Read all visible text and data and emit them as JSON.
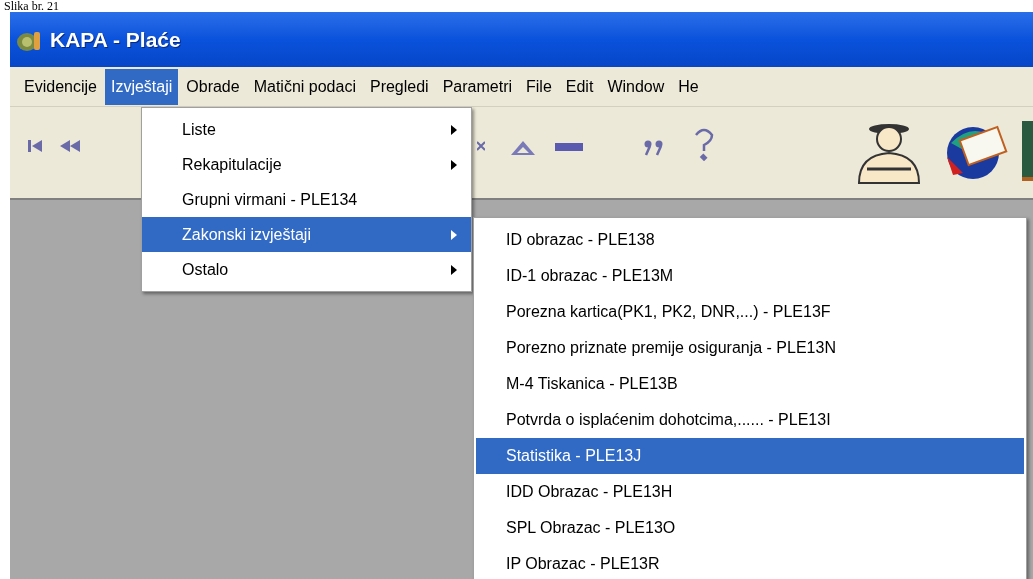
{
  "caption": "Slika br. 21",
  "window": {
    "title": "KAPA - Plaće"
  },
  "menu_bar": [
    {
      "label": "Evidencije",
      "selected": false
    },
    {
      "label": "Izvještaji",
      "selected": true
    },
    {
      "label": "Obrade",
      "selected": false
    },
    {
      "label": "Matični podaci",
      "selected": false
    },
    {
      "label": "Pregledi",
      "selected": false
    },
    {
      "label": "Parametri",
      "selected": false
    },
    {
      "label": "File",
      "selected": false
    },
    {
      "label": "Edit",
      "selected": false
    },
    {
      "label": "Window",
      "selected": false
    },
    {
      "label": "He",
      "selected": false
    }
  ],
  "menu": {
    "items": [
      {
        "label": "Liste",
        "has_submenu": true,
        "selected": false
      },
      {
        "label": "Rekapitulacije",
        "has_submenu": true,
        "selected": false
      },
      {
        "label": "Grupni virmani - PLE134",
        "has_submenu": false,
        "selected": false
      },
      {
        "label": "Zakonski izvještaji",
        "has_submenu": true,
        "selected": true
      },
      {
        "label": "Ostalo",
        "has_submenu": true,
        "selected": false
      }
    ]
  },
  "submenu": {
    "items": [
      {
        "label": "ID obrazac - PLE138",
        "selected": false
      },
      {
        "label": "ID-1 obrazac - PLE13M",
        "selected": false
      },
      {
        "label": "Porezna kartica(PK1, PK2, DNR,...) - PLE13F",
        "selected": false
      },
      {
        "label": "Porezno priznate premije osiguranja - PLE13N",
        "selected": false
      },
      {
        "label": "M-4 Tiskanica - PLE13B",
        "selected": false
      },
      {
        "label": "Potvrda o isplaćenim dohotcima,...... - PLE13I",
        "selected": false
      },
      {
        "label": "Statistika - PLE13J",
        "selected": true
      },
      {
        "label": "IDD Obrazac - PLE13H",
        "selected": false
      },
      {
        "label": "SPL Obrazac - PLE13O",
        "selected": false
      },
      {
        "label": "IP Obrazac - PLE13R",
        "selected": false
      }
    ]
  }
}
